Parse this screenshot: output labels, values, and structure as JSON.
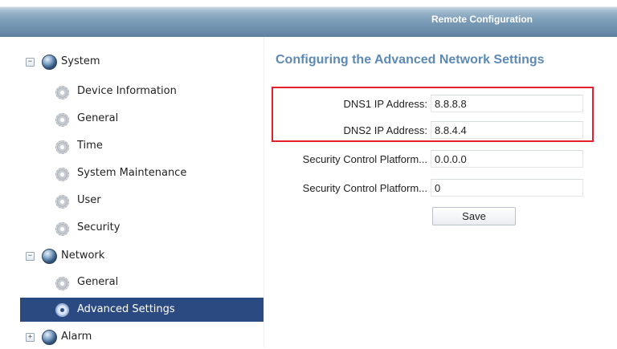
{
  "window": {
    "title": "Remote Configuration"
  },
  "tree": {
    "system": {
      "label": "System",
      "toggle": "−"
    },
    "system_items": [
      {
        "label": "Device Information"
      },
      {
        "label": "General"
      },
      {
        "label": "Time"
      },
      {
        "label": "System Maintenance"
      },
      {
        "label": "User"
      },
      {
        "label": "Security"
      }
    ],
    "network": {
      "label": "Network",
      "toggle": "−"
    },
    "network_items": [
      {
        "label": "General"
      },
      {
        "label": "Advanced Settings",
        "selected": true
      }
    ],
    "alarm": {
      "label": "Alarm",
      "toggle": "+"
    }
  },
  "panel": {
    "title": "Configuring the Advanced Network Settings",
    "fields": [
      {
        "label": "DNS1 IP Address:",
        "value": "8.8.8.8"
      },
      {
        "label": "DNS2 IP Address:",
        "value": "8.8.4.4"
      },
      {
        "label": "Security Control Platform...",
        "value": "0.0.0.0"
      },
      {
        "label": "Security Control Platform...",
        "value": "0"
      }
    ],
    "save_label": "Save"
  },
  "colors": {
    "selected_bg": "#2c4a82",
    "panel_title": "#5d8ab5",
    "highlight_border": "#e4202c"
  },
  "icons": {
    "tree_root": "globe-icon",
    "tree_child": "gear-icon",
    "collapse": "minus-toggle-icon",
    "expand": "plus-toggle-icon"
  }
}
